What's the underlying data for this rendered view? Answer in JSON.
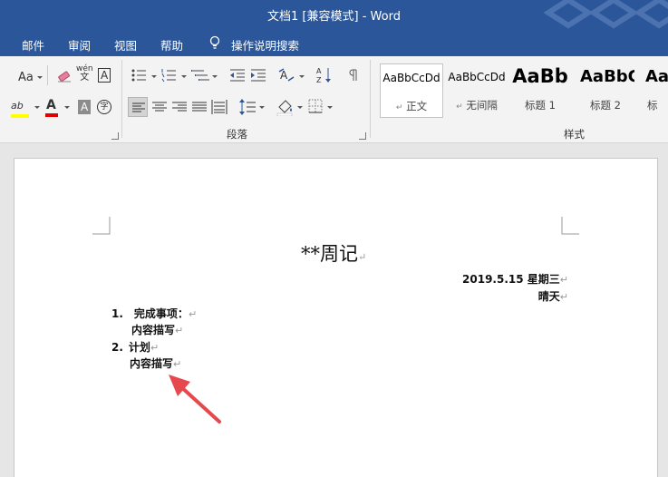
{
  "titlebar": {
    "title": "文档1 [兼容模式]  -  Word"
  },
  "menu": {
    "items": [
      "邮件",
      "审阅",
      "视图",
      "帮助"
    ],
    "tell_me": "操作说明搜索"
  },
  "ribbon": {
    "font_group": {
      "aa_label": "Aa",
      "phonetic_top": "wén",
      "phonetic_bottom": "文",
      "boxed_a": "A",
      "char_shade": "A",
      "enclose_char": "字",
      "font_color_letter": "A",
      "highlight_letters": "ab"
    },
    "paragraph_group": {
      "label": "段落"
    },
    "styles_group": {
      "label": "样式",
      "styles": [
        {
          "sample": "AaBbCcDd",
          "name": "正文",
          "mark": "↵"
        },
        {
          "sample": "AaBbCcDd",
          "name": "无间隔",
          "mark": "↵"
        },
        {
          "sample": "AaBb",
          "name": "标题 1",
          "mark": ""
        },
        {
          "sample": "AaBbC",
          "name": "标题 2",
          "mark": ""
        },
        {
          "sample": "Aa",
          "name": "标",
          "mark": ""
        }
      ]
    },
    "colors": {
      "highlight": "#ffff00",
      "font_color": "#e00000"
    }
  },
  "document": {
    "title": "**周记",
    "date_line": "2019.5.15  星期三",
    "weather": "晴天",
    "list": [
      {
        "num": "1.",
        "text": "完成事项：",
        "sub": "内容描写"
      },
      {
        "num": "2.",
        "text": "计划",
        "sub": "内容描写"
      }
    ],
    "para_mark": "↵",
    "arrow_color": "#e5484d"
  }
}
